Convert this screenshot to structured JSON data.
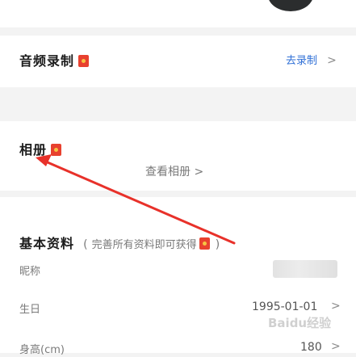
{
  "audio": {
    "title": "音频录制",
    "action": "去录制",
    "chevron": ">"
  },
  "album": {
    "title": "相册",
    "link": "查看相册 >"
  },
  "basic": {
    "title": "基本资料",
    "note_open": "(",
    "note": "完善所有资料即可获得",
    "note_close": ")"
  },
  "fields": [
    {
      "label": "昵称",
      "value": "",
      "chevron": ""
    },
    {
      "label": "生日",
      "value": "1995-01-01",
      "chevron": ">"
    },
    {
      "label": "身高(cm)",
      "value": "180",
      "chevron": ">"
    }
  ],
  "watermark": "Baidu经验",
  "icons": {
    "red_packet": "red-packet-icon",
    "chevron": "chevron-right-icon"
  },
  "colors": {
    "accent_blue": "#2f6fd6",
    "red_packet": "#e8412f",
    "arrow": "#e8312a"
  }
}
